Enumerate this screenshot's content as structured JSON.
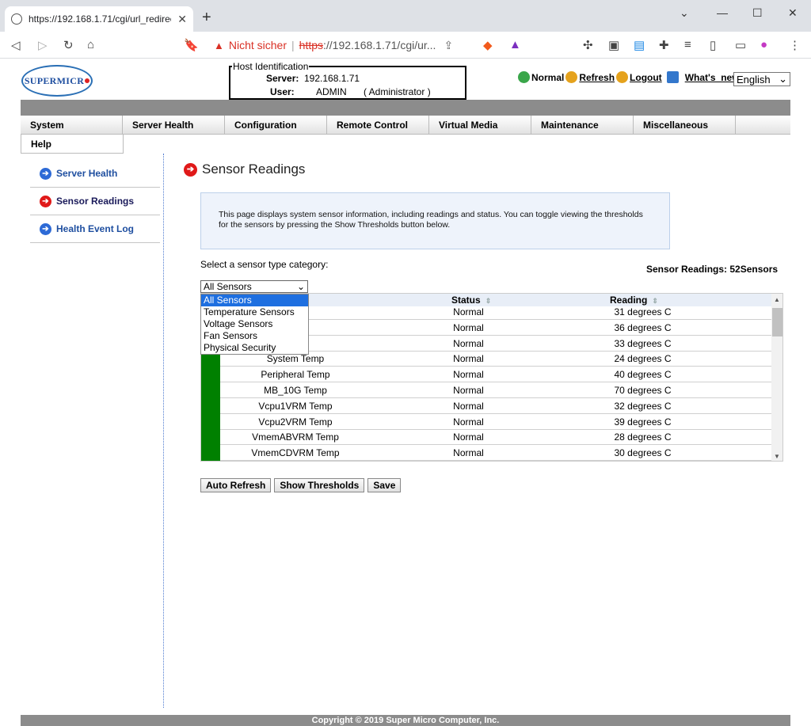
{
  "browser": {
    "tab_title": "https://192.168.1.71/cgi/url_redirect.c",
    "not_secure": "Nicht sicher",
    "url_scheme": "https",
    "url_rest": "://192.168.1.71/cgi/ur..."
  },
  "logo": {
    "text": "SUPERMICR"
  },
  "host": {
    "legend": "Host Identification",
    "server_label": "Server:",
    "server_value": "192.168.1.71",
    "user_label": "User:",
    "user_value": "ADMIN",
    "user_role": "( Administrator )"
  },
  "toplinks": {
    "status": "Normal",
    "refresh": "Refresh",
    "logout": "Logout",
    "whats_new": "What's_new",
    "language": "English"
  },
  "menu": [
    "System",
    "Server Health",
    "Configuration",
    "Remote Control",
    "Virtual Media",
    "Maintenance",
    "Miscellaneous"
  ],
  "menu_help": "Help",
  "sidebar": [
    {
      "label": "Server Health"
    },
    {
      "label": "Sensor Readings"
    },
    {
      "label": "Health Event Log"
    }
  ],
  "page": {
    "title": "Sensor Readings",
    "info": "This page displays system sensor information, including readings and status. You can toggle viewing the thresholds for the sensors by pressing the Show Thresholds button below.",
    "select_label": "Select a sensor type category:",
    "count_label": "Sensor Readings: 52Sensors",
    "select_value": "All Sensors"
  },
  "dropdown_options": [
    "All Sensors",
    "Temperature Sensors",
    "Voltage Sensors",
    "Fan Sensors",
    "Physical Security"
  ],
  "table": {
    "headers": {
      "status": "Status",
      "reading": "Reading"
    },
    "rows": [
      {
        "name": "",
        "status": "Normal",
        "reading": "31 degrees C"
      },
      {
        "name": "",
        "status": "Normal",
        "reading": "36 degrees C"
      },
      {
        "name": "",
        "status": "Normal",
        "reading": "33 degrees C"
      },
      {
        "name": "System Temp",
        "status": "Normal",
        "reading": "24 degrees C"
      },
      {
        "name": "Peripheral Temp",
        "status": "Normal",
        "reading": "40 degrees C"
      },
      {
        "name": "MB_10G Temp",
        "status": "Normal",
        "reading": "70 degrees C"
      },
      {
        "name": "Vcpu1VRM Temp",
        "status": "Normal",
        "reading": "32 degrees C"
      },
      {
        "name": "Vcpu2VRM Temp",
        "status": "Normal",
        "reading": "39 degrees C"
      },
      {
        "name": "VmemABVRM Temp",
        "status": "Normal",
        "reading": "28 degrees C"
      },
      {
        "name": "VmemCDVRM Temp",
        "status": "Normal",
        "reading": "30 degrees C"
      }
    ]
  },
  "buttons": {
    "auto_refresh": "Auto Refresh",
    "show_thresholds": "Show Thresholds",
    "save": "Save"
  },
  "footer": "Copyright © 2019 Super Micro Computer, Inc.",
  "colors": {
    "status_ok": "#008000",
    "accent_blue": "#1f4fa0",
    "active_arrow": "#e01919"
  }
}
